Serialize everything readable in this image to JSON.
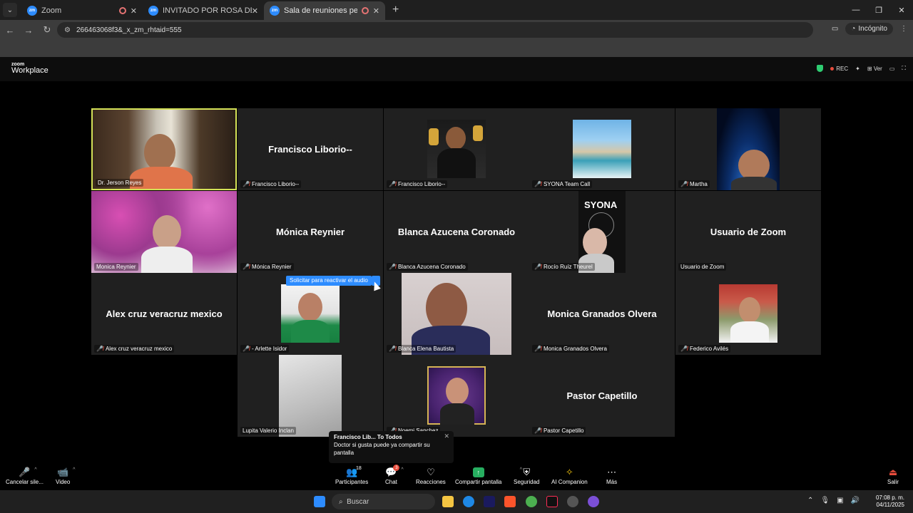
{
  "browser": {
    "tabs": [
      {
        "title": "Zoom",
        "icon": "zoom-favicon",
        "recording": true,
        "active": false
      },
      {
        "title": "INVITADO POR ROSA DE PAZ",
        "icon": "zoom-favicon",
        "recording": false,
        "active": false
      },
      {
        "title": "Sala de reuniones personal",
        "icon": "zoom-favicon",
        "recording": true,
        "active": true
      }
    ],
    "favicon_text": "zm",
    "url": "266463068f3&_x_zm_rhtaid=555",
    "incognito_label": "Incógnito"
  },
  "zoom": {
    "logo_top": "zoom",
    "logo_bottom": "Workplace",
    "rec_label": "REC",
    "view_label": "Ver"
  },
  "tiles": [
    {
      "label": "Dr. Jerson Reyes",
      "center": "",
      "muted": false,
      "kind": "office"
    },
    {
      "label": "Francisco Liborio--",
      "center": "Francisco Liborio--",
      "muted": true,
      "kind": "name"
    },
    {
      "label": "Francisco Liborio--",
      "center": "",
      "muted": true,
      "kind": "trophy"
    },
    {
      "label": "SYONA Team Call",
      "center": "",
      "muted": true,
      "kind": "hotel"
    },
    {
      "label": "Martha",
      "center": "",
      "muted": true,
      "kind": "space"
    },
    {
      "label": "Monica Reynier",
      "center": "",
      "muted": false,
      "kind": "blossom"
    },
    {
      "label": "Mónica Reynier",
      "center": "Mónica Reynier",
      "muted": true,
      "kind": "name"
    },
    {
      "label": "Blanca Azucena Coronado",
      "center": "Blanca Azucena Coronado",
      "muted": true,
      "kind": "name"
    },
    {
      "label": "Rocío Ruíz Theurel",
      "center": "",
      "muted": true,
      "kind": "syona",
      "overlay_text": "SYONA"
    },
    {
      "label": "Usuario de Zoom",
      "center": "Usuario de Zoom",
      "muted": false,
      "kind": "name"
    },
    {
      "label": "Alex cruz veracruz mexico",
      "center": "Alex cruz veracruz mexico",
      "muted": true,
      "kind": "name"
    },
    {
      "label": "- Arlette Isidor",
      "center": "",
      "muted": true,
      "kind": "green"
    },
    {
      "label": "Blanca Elena Bautista",
      "center": "",
      "muted": true,
      "kind": "elder"
    },
    {
      "label": "Monica Granados Olvera",
      "center": "Monica Granados Olvera",
      "muted": true,
      "kind": "name"
    },
    {
      "label": "Federico Avilés",
      "center": "",
      "muted": true,
      "kind": "cafe"
    },
    {
      "label": "Lupita Valerio Inclan",
      "center": "",
      "muted": false,
      "kind": "wall"
    },
    {
      "label": "Noemi Sanchez",
      "center": "",
      "muted": true,
      "kind": "frame"
    },
    {
      "label": "Pastor Capetillo",
      "center": "Pastor Capetillo",
      "muted": true,
      "kind": "name"
    }
  ],
  "tooltip": "Solicitar para reactivar el audio",
  "chat_popup": {
    "from": "Francisco Lib... To Todos",
    "message": "Doctor si gusta puede ya compartir su pantalla"
  },
  "toolbar": {
    "mute_label": "Cancelar sile...",
    "video_label": "Video",
    "participants_label": "Participantes",
    "participants_count": "18",
    "chat_label": "Chat",
    "chat_badge": "3",
    "reactions_label": "Reacciones",
    "share_label": "Compartir pantalla",
    "security_label": "Seguridad",
    "ai_label": "AI Companion",
    "more_label": "Más",
    "leave_label": "Salir"
  },
  "taskbar": {
    "search_placeholder": "Buscar",
    "time": "07:08 p. m.",
    "date": "04/11/2025"
  },
  "colors": {
    "zoom_blue": "#2d8cff",
    "mute_red": "#e74c3c",
    "share_green": "#27ae60",
    "tile_bg": "#202020",
    "highlight": "#d4e157"
  }
}
